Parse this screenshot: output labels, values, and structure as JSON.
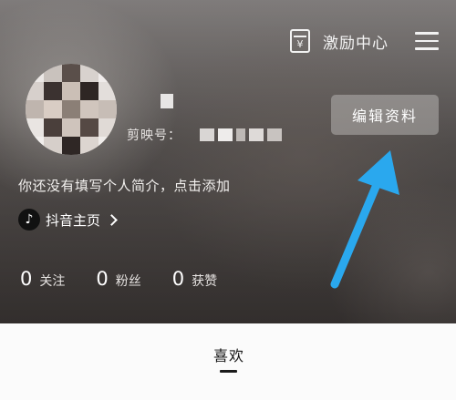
{
  "header": {
    "reward_center_label": "激励中心",
    "reward_icon_glyph": "¥",
    "menu_icon": "hamburger-menu-icon"
  },
  "profile": {
    "id_label": "剪映号：",
    "edit_profile_label": "编辑资料",
    "bio_placeholder": "你还没有填写个人简介，点击添加",
    "douyin": {
      "logo_glyph": "♪",
      "label": "抖音主页"
    }
  },
  "stats": [
    {
      "count": "0",
      "label": "关注"
    },
    {
      "count": "0",
      "label": "粉丝"
    },
    {
      "count": "0",
      "label": "获赞"
    }
  ],
  "tabs": [
    {
      "label": "喜欢",
      "active": true
    }
  ],
  "colors": {
    "annotation_arrow": "#2aa8ee",
    "tab_indicator": "#1a1a1a"
  }
}
